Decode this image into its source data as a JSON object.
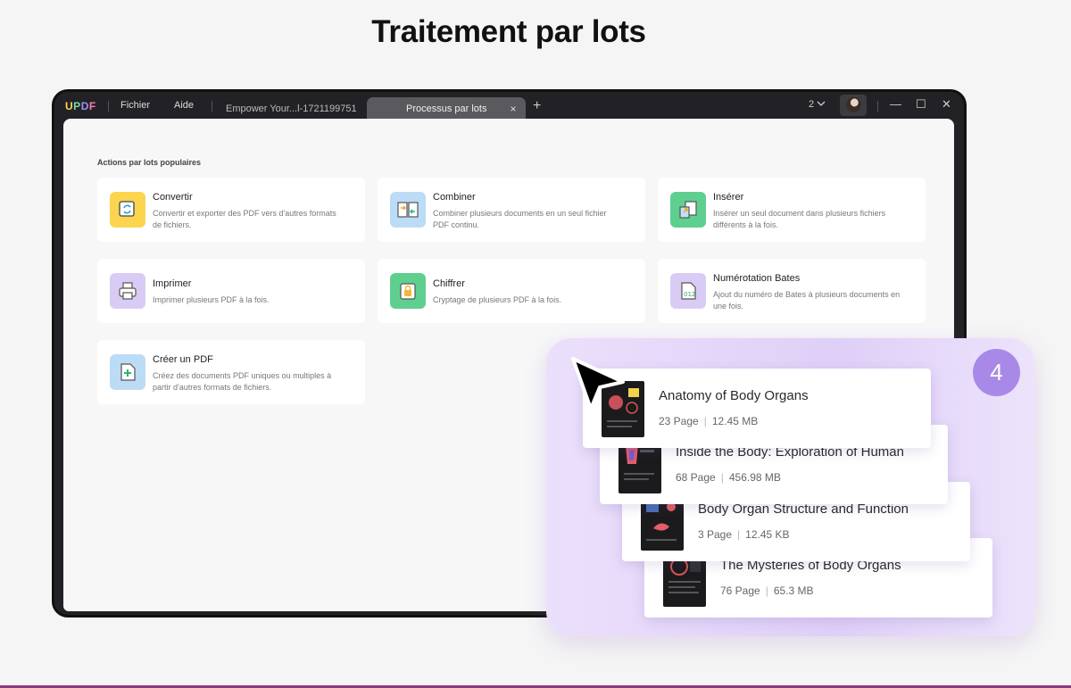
{
  "page": {
    "title": "Traitement par lots"
  },
  "app": {
    "logo": {
      "u": "U",
      "p": "P",
      "d": "D",
      "f": "F"
    },
    "menu": {
      "file": "Fichier",
      "help": "Aide"
    },
    "tabs": [
      {
        "label": "Empower Your...l-1721199751"
      },
      {
        "label": "Processus par lots",
        "close": "×"
      }
    ],
    "new_tab": "+",
    "window_count": "2",
    "controls": {
      "minimize": "—",
      "maximize": "☐",
      "close": "✕"
    }
  },
  "batch": {
    "section_label": "Actions par lots populaires",
    "actions": [
      {
        "title": "Convertir",
        "desc": "Convertir et exporter des PDF vers d'autres formats de fichiers.",
        "icon": "convert-icon",
        "color": "#fbd54f"
      },
      {
        "title": "Combiner",
        "desc": "Combiner plusieurs documents en un seul fichier PDF continu.",
        "icon": "combine-icon",
        "color": "#bcdcf5"
      },
      {
        "title": "Insérer",
        "desc": "Insérer un seul document dans plusieurs fichiers différents à la fois.",
        "icon": "insert-icon",
        "color": "#5fcf90"
      },
      {
        "title": "Imprimer",
        "desc": "Imprimer plusieurs PDF à la fois.",
        "icon": "printer-icon",
        "color": "#d9ccf4"
      },
      {
        "title": "Chiffrer",
        "desc": "Cryptage de plusieurs PDF à la fois.",
        "icon": "lock-icon",
        "color": "#5fcf90"
      },
      {
        "title": "Numérotation Bates",
        "desc": "Ajout du numéro de Bates à plusieurs documents en une fois.",
        "icon": "bates-number-icon",
        "color": "#d9ccf4"
      },
      {
        "title": "Créer un PDF",
        "desc": "Créez des documents PDF uniques ou multiples à partir d'autres formats de fichiers.",
        "icon": "create-pdf-icon",
        "color": "#bcdcf5"
      }
    ]
  },
  "selection": {
    "count": "4",
    "files": [
      {
        "name": "Anatomy of Body Organs",
        "pages": "23 Page",
        "size": "12.45 MB"
      },
      {
        "name": "Inside the Body: Exploration of Human",
        "pages": "68 Page",
        "size": "456.98 MB"
      },
      {
        "name": "Body Organ Structure and Function",
        "pages": "3 Page",
        "size": "12.45 KB"
      },
      {
        "name": "The Mysteries of Body Organs",
        "pages": "76 Page",
        "size": "65.3 MB"
      }
    ]
  }
}
